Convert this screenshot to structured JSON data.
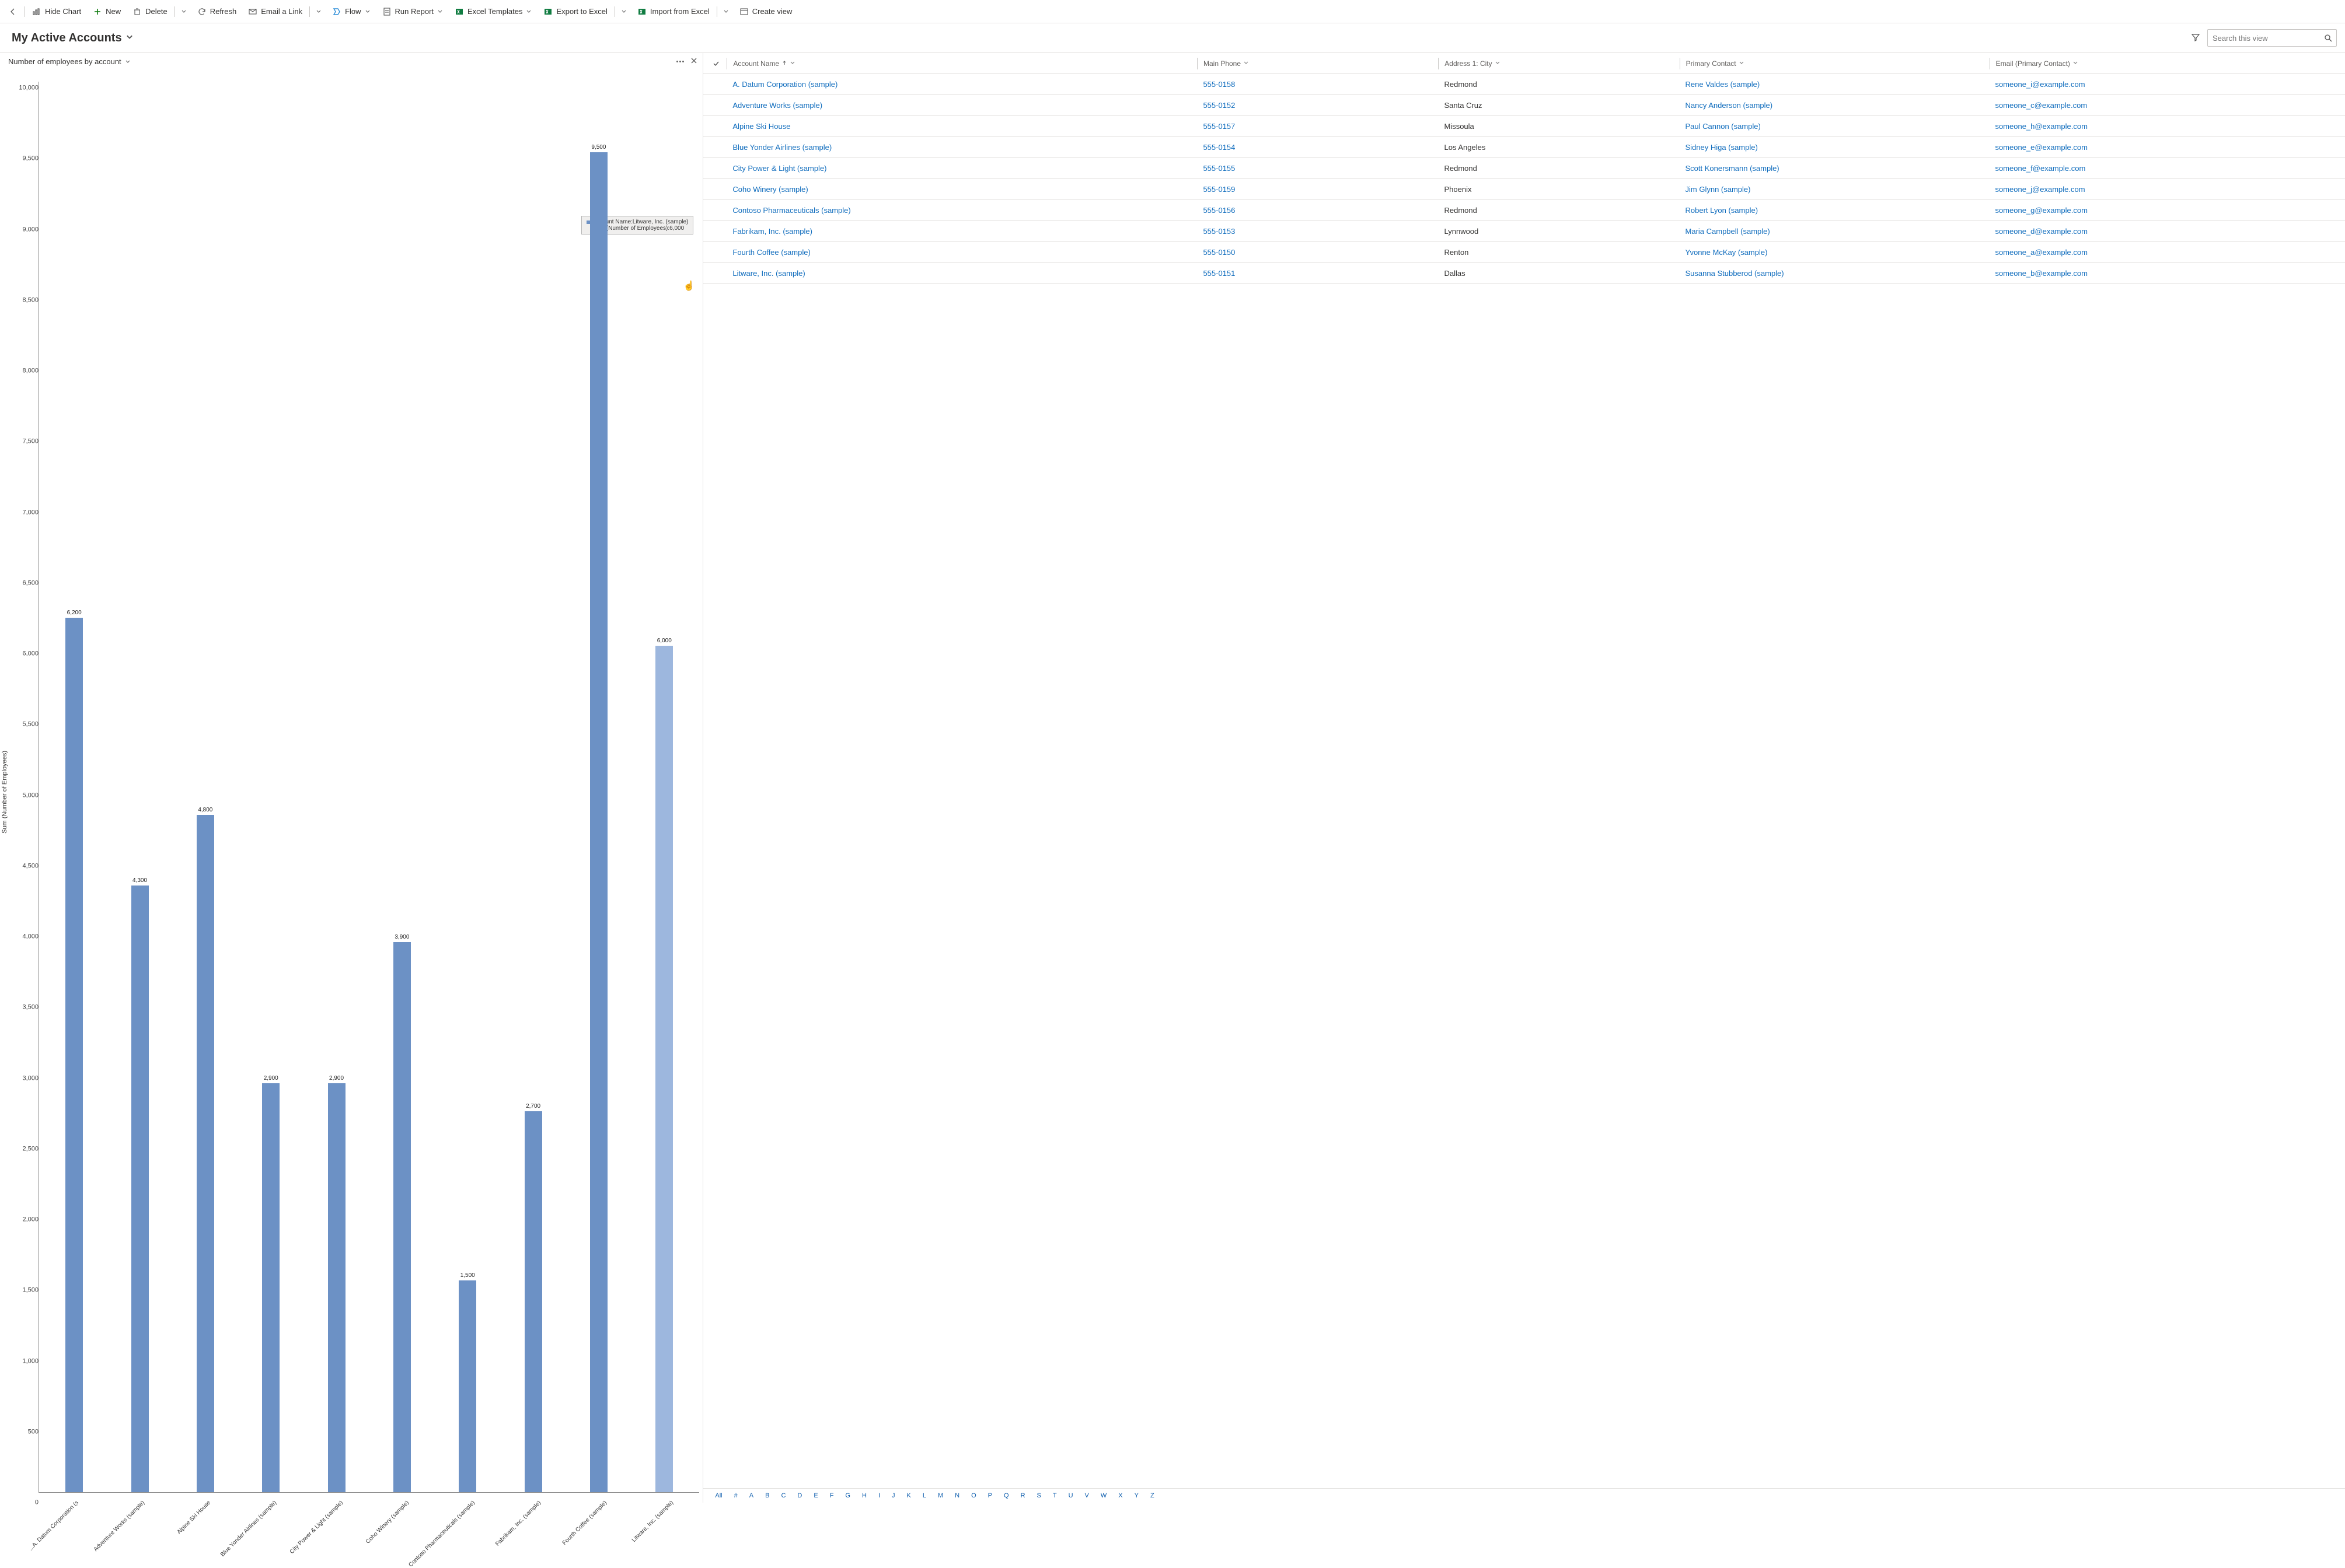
{
  "cmd": {
    "back": "Back",
    "hide_chart": "Hide Chart",
    "new": "New",
    "delete": "Delete",
    "refresh": "Refresh",
    "email_link": "Email a Link",
    "flow": "Flow",
    "run_report": "Run Report",
    "excel_tpl": "Excel Templates",
    "export_excel": "Export to Excel",
    "import_excel": "Import from Excel",
    "create_view": "Create view"
  },
  "title": "My Active Accounts",
  "search_placeholder": "Search this view",
  "chart": {
    "title": "Number of employees by account",
    "y_label": "Sum (Number of Employees)"
  },
  "tooltip": {
    "line1": "Account Name:Litware, Inc. (sample)",
    "line2": "Sum (Number of Employees):6,000"
  },
  "columns": {
    "name": "Account Name",
    "phone": "Main Phone",
    "city": "Address 1: City",
    "contact": "Primary Contact",
    "email": "Email (Primary Contact)"
  },
  "grid": [
    {
      "name": "A. Datum Corporation (sample)",
      "phone": "555-0158",
      "city": "Redmond",
      "contact": "Rene Valdes (sample)",
      "email": "someone_i@example.com"
    },
    {
      "name": "Adventure Works (sample)",
      "phone": "555-0152",
      "city": "Santa Cruz",
      "contact": "Nancy Anderson (sample)",
      "email": "someone_c@example.com"
    },
    {
      "name": "Alpine Ski House",
      "phone": "555-0157",
      "city": "Missoula",
      "contact": "Paul Cannon (sample)",
      "email": "someone_h@example.com"
    },
    {
      "name": "Blue Yonder Airlines (sample)",
      "phone": "555-0154",
      "city": "Los Angeles",
      "contact": "Sidney Higa (sample)",
      "email": "someone_e@example.com"
    },
    {
      "name": "City Power & Light (sample)",
      "phone": "555-0155",
      "city": "Redmond",
      "contact": "Scott Konersmann (sample)",
      "email": "someone_f@example.com"
    },
    {
      "name": "Coho Winery (sample)",
      "phone": "555-0159",
      "city": "Phoenix",
      "contact": "Jim Glynn (sample)",
      "email": "someone_j@example.com"
    },
    {
      "name": "Contoso Pharmaceuticals (sample)",
      "phone": "555-0156",
      "city": "Redmond",
      "contact": "Robert Lyon (sample)",
      "email": "someone_g@example.com"
    },
    {
      "name": "Fabrikam, Inc. (sample)",
      "phone": "555-0153",
      "city": "Lynnwood",
      "contact": "Maria Campbell (sample)",
      "email": "someone_d@example.com"
    },
    {
      "name": "Fourth Coffee (sample)",
      "phone": "555-0150",
      "city": "Renton",
      "contact": "Yvonne McKay (sample)",
      "email": "someone_a@example.com"
    },
    {
      "name": "Litware, Inc. (sample)",
      "phone": "555-0151",
      "city": "Dallas",
      "contact": "Susanna Stubberod (sample)",
      "email": "someone_b@example.com"
    }
  ],
  "index": [
    "All",
    "#",
    "A",
    "B",
    "C",
    "D",
    "E",
    "F",
    "G",
    "H",
    "I",
    "J",
    "K",
    "L",
    "M",
    "N",
    "O",
    "P",
    "Q",
    "R",
    "S",
    "T",
    "U",
    "V",
    "W",
    "X",
    "Y",
    "Z"
  ],
  "chart_data": {
    "type": "bar",
    "title": "Number of employees by account",
    "xlabel": "",
    "ylabel": "Sum (Number of Employees)",
    "ylim": [
      0,
      10000
    ],
    "y_ticks": [
      10000,
      9500,
      9000,
      8500,
      8000,
      7500,
      7000,
      6500,
      6000,
      5500,
      5000,
      4500,
      4000,
      3500,
      3000,
      2500,
      2000,
      1500,
      1000,
      500,
      0
    ],
    "y_tick_labels": [
      "10,000",
      "9,500",
      "9,000",
      "8,500",
      "8,000",
      "7,500",
      "7,000",
      "6,500",
      "6,000",
      "5,500",
      "5,000",
      "4,500",
      "4,000",
      "3,500",
      "3,000",
      "2,500",
      "2,000",
      "1,500",
      "1,000",
      "500",
      "0"
    ],
    "categories": [
      "A. Datum Corporation (s...",
      "Adventure Works (sample)",
      "Alpine Ski House",
      "Blue Yonder Airlines (sample)",
      "City Power & Light (sample)",
      "Coho Winery (sample)",
      "Contoso Pharmaceuticals (sample)",
      "Fabrikam, Inc. (sample)",
      "Fourth Coffee (sample)",
      "Litware, Inc. (sample)"
    ],
    "values": [
      6200,
      4300,
      4800,
      2900,
      2900,
      3900,
      1500,
      2700,
      9500,
      6000
    ],
    "value_labels": [
      "6,200",
      "4,300",
      "4,800",
      "2,900",
      "2,900",
      "3,900",
      "1,500",
      "2,700",
      "9,500",
      "6,000"
    ],
    "highlight_index": 9
  }
}
